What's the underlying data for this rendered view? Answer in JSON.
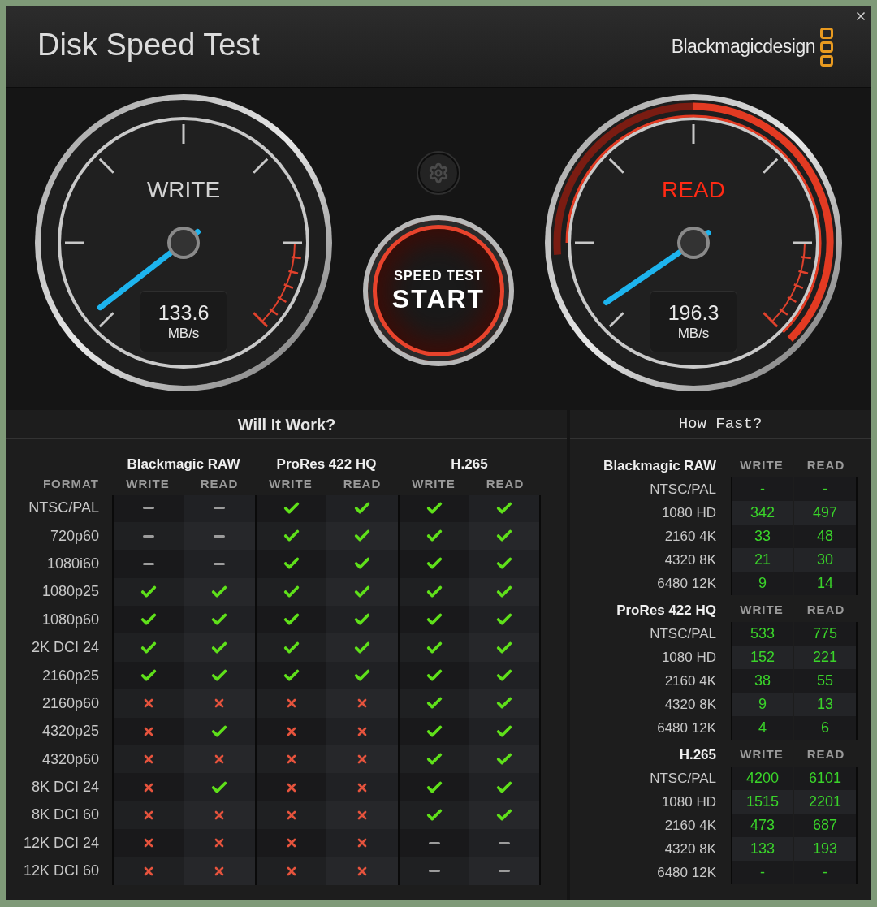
{
  "window": {
    "title": "Disk Speed Test",
    "brand": "Blackmagicdesign"
  },
  "gauges": [
    {
      "label": "WRITE",
      "value": "133.6",
      "unit": "MB/s",
      "active": false
    },
    {
      "label": "READ",
      "value": "196.3",
      "unit": "MB/s",
      "active": true
    }
  ],
  "start_button": {
    "caption": "SPEED TEST",
    "label": "START"
  },
  "will_it_work": {
    "title": "Will It Work?",
    "format_header": "FORMAT",
    "codecs": [
      {
        "name": "Blackmagic RAW",
        "columns": [
          "WRITE",
          "READ"
        ]
      },
      {
        "name": "ProRes 422 HQ",
        "columns": [
          "WRITE",
          "READ"
        ]
      },
      {
        "name": "H.265",
        "columns": [
          "WRITE",
          "READ"
        ]
      }
    ],
    "rows": [
      {
        "format": "NTSC/PAL",
        "cells": [
          {
            "kind": "dash"
          },
          {
            "kind": "dash"
          },
          {
            "kind": "check"
          },
          {
            "kind": "check"
          },
          {
            "kind": "check"
          },
          {
            "kind": "check"
          }
        ]
      },
      {
        "format": "720p60",
        "cells": [
          {
            "kind": "dash"
          },
          {
            "kind": "dash"
          },
          {
            "kind": "check"
          },
          {
            "kind": "check"
          },
          {
            "kind": "check"
          },
          {
            "kind": "check"
          }
        ]
      },
      {
        "format": "1080i60",
        "cells": [
          {
            "kind": "dash"
          },
          {
            "kind": "dash"
          },
          {
            "kind": "check"
          },
          {
            "kind": "check"
          },
          {
            "kind": "check"
          },
          {
            "kind": "check"
          }
        ]
      },
      {
        "format": "1080p25",
        "cells": [
          {
            "kind": "check"
          },
          {
            "kind": "check"
          },
          {
            "kind": "check"
          },
          {
            "kind": "check"
          },
          {
            "kind": "check"
          },
          {
            "kind": "check"
          }
        ]
      },
      {
        "format": "1080p60",
        "cells": [
          {
            "kind": "check"
          },
          {
            "kind": "check"
          },
          {
            "kind": "check"
          },
          {
            "kind": "check"
          },
          {
            "kind": "check"
          },
          {
            "kind": "check"
          }
        ]
      },
      {
        "format": "2K DCI 24",
        "cells": [
          {
            "kind": "check"
          },
          {
            "kind": "check"
          },
          {
            "kind": "check"
          },
          {
            "kind": "check"
          },
          {
            "kind": "check"
          },
          {
            "kind": "check"
          }
        ]
      },
      {
        "format": "2160p25",
        "cells": [
          {
            "kind": "check"
          },
          {
            "kind": "check"
          },
          {
            "kind": "check"
          },
          {
            "kind": "check"
          },
          {
            "kind": "check"
          },
          {
            "kind": "check"
          }
        ]
      },
      {
        "format": "2160p60",
        "cells": [
          {
            "kind": "cross"
          },
          {
            "kind": "cross"
          },
          {
            "kind": "cross"
          },
          {
            "kind": "cross"
          },
          {
            "kind": "check"
          },
          {
            "kind": "check"
          }
        ]
      },
      {
        "format": "4320p25",
        "cells": [
          {
            "kind": "cross"
          },
          {
            "kind": "check"
          },
          {
            "kind": "cross"
          },
          {
            "kind": "cross"
          },
          {
            "kind": "check"
          },
          {
            "kind": "check"
          }
        ]
      },
      {
        "format": "4320p60",
        "cells": [
          {
            "kind": "cross"
          },
          {
            "kind": "cross"
          },
          {
            "kind": "cross"
          },
          {
            "kind": "cross"
          },
          {
            "kind": "check"
          },
          {
            "kind": "check"
          }
        ]
      },
      {
        "format": "8K DCI 24",
        "cells": [
          {
            "kind": "cross"
          },
          {
            "kind": "check"
          },
          {
            "kind": "cross"
          },
          {
            "kind": "cross"
          },
          {
            "kind": "check"
          },
          {
            "kind": "check"
          }
        ]
      },
      {
        "format": "8K DCI 60",
        "cells": [
          {
            "kind": "cross"
          },
          {
            "kind": "cross"
          },
          {
            "kind": "cross"
          },
          {
            "kind": "cross"
          },
          {
            "kind": "check"
          },
          {
            "kind": "check"
          }
        ]
      },
      {
        "format": "12K DCI 24",
        "cells": [
          {
            "kind": "cross"
          },
          {
            "kind": "cross"
          },
          {
            "kind": "cross"
          },
          {
            "kind": "cross"
          },
          {
            "kind": "dash"
          },
          {
            "kind": "dash"
          }
        ]
      },
      {
        "format": "12K DCI 60",
        "cells": [
          {
            "kind": "cross"
          },
          {
            "kind": "cross"
          },
          {
            "kind": "cross"
          },
          {
            "kind": "cross"
          },
          {
            "kind": "dash"
          },
          {
            "kind": "dash"
          }
        ]
      }
    ]
  },
  "how_fast": {
    "title": "How Fast?",
    "groups": [
      {
        "name": "Blackmagic RAW",
        "columns": [
          "WRITE",
          "READ"
        ],
        "rows": [
          {
            "format": "NTSC/PAL",
            "write": "-",
            "read": "-"
          },
          {
            "format": "1080 HD",
            "write": "342",
            "read": "497"
          },
          {
            "format": "2160 4K",
            "write": "33",
            "read": "48"
          },
          {
            "format": "4320 8K",
            "write": "21",
            "read": "30"
          },
          {
            "format": "6480 12K",
            "write": "9",
            "read": "14"
          }
        ]
      },
      {
        "name": "ProRes 422 HQ",
        "columns": [
          "WRITE",
          "READ"
        ],
        "rows": [
          {
            "format": "NTSC/PAL",
            "write": "533",
            "read": "775"
          },
          {
            "format": "1080 HD",
            "write": "152",
            "read": "221"
          },
          {
            "format": "2160 4K",
            "write": "38",
            "read": "55"
          },
          {
            "format": "4320 8K",
            "write": "9",
            "read": "13"
          },
          {
            "format": "6480 12K",
            "write": "4",
            "read": "6"
          }
        ]
      },
      {
        "name": "H.265",
        "columns": [
          "WRITE",
          "READ"
        ],
        "rows": [
          {
            "format": "NTSC/PAL",
            "write": "4200",
            "read": "6101"
          },
          {
            "format": "1080 HD",
            "write": "1515",
            "read": "2201"
          },
          {
            "format": "2160 4K",
            "write": "473",
            "read": "687"
          },
          {
            "format": "4320 8K",
            "write": "133",
            "read": "193"
          },
          {
            "format": "6480 12K",
            "write": "-",
            "read": "-"
          }
        ]
      }
    ]
  }
}
